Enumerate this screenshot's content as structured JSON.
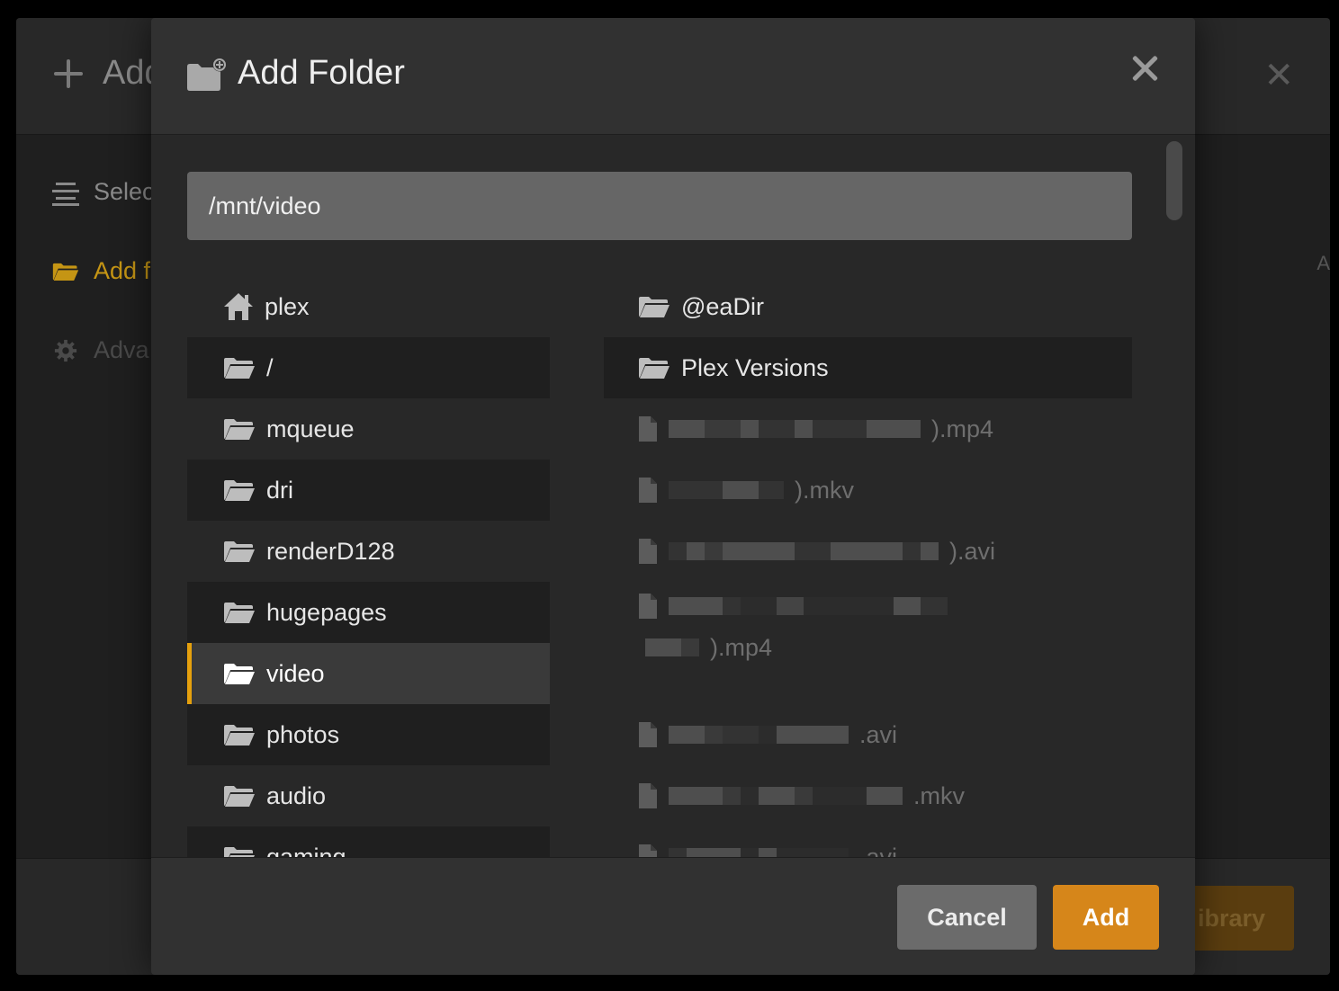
{
  "background_dialog": {
    "title": "Add",
    "close_glyph": "✕",
    "nav": [
      {
        "label": "Selec",
        "icon": "lines-icon"
      },
      {
        "label": "Add f",
        "icon": "folder-open-icon"
      },
      {
        "label": "Adva",
        "icon": "gear-icon"
      }
    ],
    "footer_button": "ibrary",
    "edge_text": "A"
  },
  "modal": {
    "title": "Add Folder",
    "icon": "folder-plus-icon",
    "path_value": "/mnt/video",
    "left_items": [
      {
        "label": "plex",
        "icon": "home-icon"
      },
      {
        "label": "/",
        "icon": "folder-icon"
      },
      {
        "label": "mqueue",
        "icon": "folder-icon"
      },
      {
        "label": "dri",
        "icon": "folder-icon"
      },
      {
        "label": "renderD128",
        "icon": "folder-icon"
      },
      {
        "label": "hugepages",
        "icon": "folder-icon"
      },
      {
        "label": "video",
        "icon": "folder-icon",
        "selected": true
      },
      {
        "label": "photos",
        "icon": "folder-icon"
      },
      {
        "label": "audio",
        "icon": "folder-icon"
      },
      {
        "label": "gaming",
        "icon": "folder-icon"
      }
    ],
    "right_dirs": [
      {
        "label": "@eaDir",
        "icon": "folder-icon"
      },
      {
        "label": "Plex Versions",
        "icon": "folder-icon"
      }
    ],
    "right_files": [
      {
        "suffix": ").mp4",
        "icon": "file-icon"
      },
      {
        "suffix": ").mkv",
        "icon": "file-icon"
      },
      {
        "suffix": ").avi",
        "icon": "file-icon"
      },
      {
        "suffix": ").mp4",
        "icon": "file-icon"
      },
      {
        "suffix": ".avi",
        "icon": "file-icon"
      },
      {
        "suffix": ".mkv",
        "icon": "file-icon"
      },
      {
        "suffix": ".avi",
        "icon": "file-icon"
      }
    ],
    "buttons": {
      "cancel": "Cancel",
      "add": "Add"
    }
  },
  "colors": {
    "accent": "#e5a00d",
    "add_button": "#d6861a",
    "cancel_button": "#6b6b6b",
    "modal_bg": "#282828",
    "path_input_bg": "#666666"
  }
}
